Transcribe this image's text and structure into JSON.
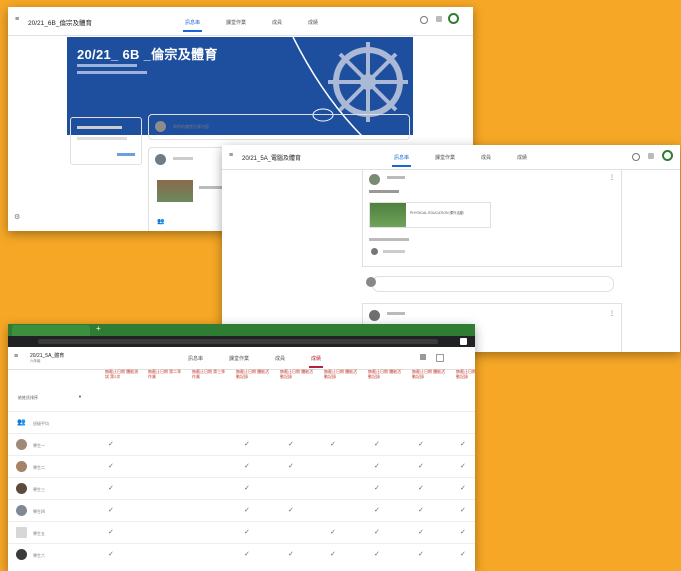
{
  "window1": {
    "title": "20/21_6B_倫宗及體育",
    "tabs": [
      "訊息串",
      "課堂作業",
      "成員",
      "成績"
    ],
    "banner_title": "20/21_ 6B _倫宗及體育",
    "announce_placeholder": "與你的課堂分享內容"
  },
  "window2": {
    "title": "20/21_5A_電腦及體育",
    "tabs": [
      "訊息串",
      "課堂作業",
      "成員",
      "成績"
    ],
    "attach_title": "PHYSICAL EDUCATION 課外活動"
  },
  "window3": {
    "title": "20/21_5A_體育",
    "subtitle": "六年級",
    "tabs": [
      "訊息串",
      "課堂作業",
      "成員",
      "成績"
    ],
    "sort_label": "依姓氏排序",
    "class_avg": "班級平均",
    "headers": [
      "無截止日期 體能測試 第2次",
      "無截止日期 第二季 作業",
      "無截止日期 第三季 作業",
      "無截止日期 體能活動記錄",
      "無截止日期 體能活動記錄",
      "無截止日期 體能活動記錄",
      "無截止日期 體能活動記錄",
      "無截止日期 體能活動記錄",
      "無截止日期 體能活動記錄"
    ],
    "rows": [
      {
        "name": "學生一"
      },
      {
        "name": "學生二"
      },
      {
        "name": "學生三"
      },
      {
        "name": "學生四"
      },
      {
        "name": "學生五"
      },
      {
        "name": "學生六"
      }
    ],
    "check": "✓"
  }
}
